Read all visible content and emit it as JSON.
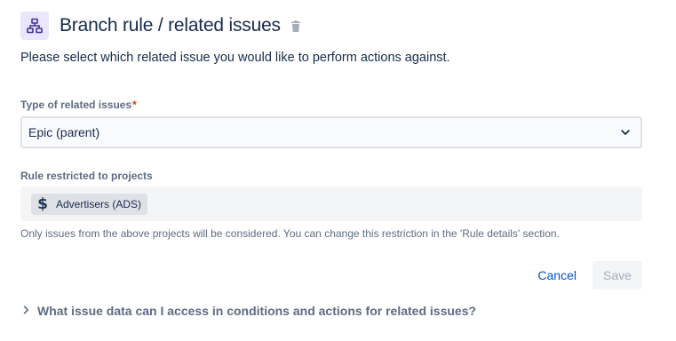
{
  "header": {
    "title": "Branch rule / related issues",
    "icon": "branch-icon",
    "delete_icon": "trash-icon"
  },
  "description": "Please select which related issue you would like to perform actions against.",
  "related_type": {
    "label": "Type of related issues",
    "required_marker": "*",
    "value": "Epic (parent)"
  },
  "projects": {
    "label": "Rule restricted to projects",
    "chips": [
      {
        "icon": "dollar-icon",
        "symbol": "$",
        "label": "Advertisers (ADS)"
      }
    ],
    "helper": "Only issues from the above projects will be considered. You can change this restriction in the 'Rule details' section."
  },
  "actions": {
    "cancel_label": "Cancel",
    "save_label": "Save"
  },
  "expander": {
    "label": "What issue data can I access in conditions and actions for related issues?"
  },
  "colors": {
    "accent": "#0052cc",
    "icon_bg": "#eae6ff",
    "icon_fg": "#403294",
    "required": "#de350b"
  }
}
